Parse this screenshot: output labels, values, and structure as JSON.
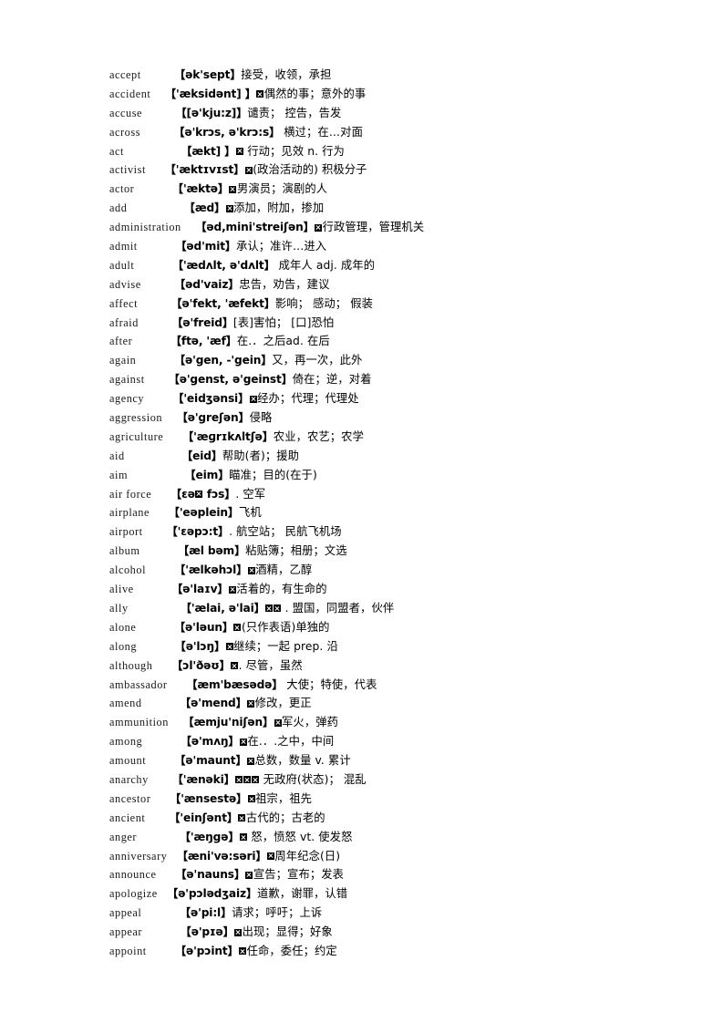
{
  "document": {
    "type": "vocabulary-glossary",
    "language_pair": "English-Chinese",
    "page_background": "#ffffff",
    "text_color": "#000000",
    "entry_count": 47
  },
  "entries": [
    {
      "word": "accept",
      "gap": 7,
      "phonetic": "【ək'sept】",
      "boxes": 0,
      "definition": "接受，收领，承担"
    },
    {
      "word": "accident",
      "gap": 3,
      "phonetic": "【'æksidənt] 】",
      "boxes": 1,
      "definition": "偶然的事；意外的事"
    },
    {
      "word": "accuse",
      "gap": 7,
      "phonetic": "【[ə'kju:z]】",
      "boxes": 0,
      "definition": "谴责；  控告，告发"
    },
    {
      "word": "across",
      "gap": 7,
      "phonetic": "【ə'krɔs, ə'krɔ:s】",
      "boxes": 0,
      "definition": "  横过；在…对面"
    },
    {
      "word": "act",
      "gap": 12,
      "phonetic": "【ækt] 】",
      "boxes": 1,
      "definition": " 行动；见效 n. 行为"
    },
    {
      "word": "activist",
      "gap": 4,
      "phonetic": "【'æktɪvɪst】",
      "boxes": 1,
      "definition": "(政治活动的) 积极分子"
    },
    {
      "word": "actor",
      "gap": 8,
      "phonetic": "【'æktə】",
      "boxes": 1,
      "definition": "男演员；演剧的人"
    },
    {
      "word": "add",
      "gap": 12,
      "phonetic": "【æd】",
      "boxes": 1,
      "definition": "添加，附加，掺加"
    },
    {
      "word": "administration",
      "gap": 3,
      "phonetic": "【əd,mini'streiʃən】",
      "boxes": 1,
      "definition": "行政管理，管理机关"
    },
    {
      "word": "admit",
      "gap": 8,
      "phonetic": "【əd'mit】",
      "boxes": 0,
      "definition": "承认；准许…进入"
    },
    {
      "word": "adult",
      "gap": 8,
      "phonetic": "【'ædʌlt, ə'dʌlt】",
      "boxes": 0,
      "definition": " 成年人 adj. 成年的"
    },
    {
      "word": "advise",
      "gap": 7,
      "phonetic": "【əd'vaiz】",
      "boxes": 0,
      "definition": "忠告，劝告，建议"
    },
    {
      "word": "affect",
      "gap": 7,
      "phonetic": "【ə'fekt, 'æfekt】",
      "boxes": 0,
      "definition": "影响；  感动；  假装"
    },
    {
      "word": "afraid",
      "gap": 7,
      "phonetic": "【ə'freid】",
      "boxes": 0,
      "definition": "[表]害怕；  [口]恐怕"
    },
    {
      "word": "after",
      "gap": 8,
      "phonetic": "【ftə, 'æf】",
      "boxes": 0,
      "definition": "在.．之后ad. 在后"
    },
    {
      "word": "again",
      "gap": 8,
      "phonetic": "【ə'gen, -'gein】",
      "boxes": 0,
      "definition": "又，再一次，此外"
    },
    {
      "word": "against",
      "gap": 5,
      "phonetic": "【ə'genst, ə'geinst】",
      "boxes": 0,
      "definition": "倚在；逆，对着"
    },
    {
      "word": "agency",
      "gap": 6,
      "phonetic": "【'eidʒənsi】",
      "boxes": 1,
      "definition": "经办；代理；代理处"
    },
    {
      "word": "aggression",
      "gap": 3,
      "phonetic": "【ə'greʃən】",
      "boxes": 0,
      "definition": "侵略"
    },
    {
      "word": "agriculture",
      "gap": 4,
      "phonetic": "【'æɡrɪkʌltʃə】",
      "boxes": 0,
      "definition": "农业，农艺；农学"
    },
    {
      "word": "aid",
      "gap": 12,
      "phonetic": "【eid】",
      "boxes": 0,
      "definition": "帮助(者)；援助"
    },
    {
      "word": "aim",
      "gap": 12,
      "phonetic": "【eim】",
      "boxes": 0,
      "definition": "瞄准；目的(在于)"
    },
    {
      "word": "air force",
      "gap": 4,
      "phonetic": "【ɛə□ fɔs】",
      "boxes": 0,
      "definition": ". 空军",
      "inline_box_after": 1
    },
    {
      "word": "airplane",
      "gap": 4,
      "phonetic": "【'eəplein】",
      "boxes": 0,
      "definition": "飞机"
    },
    {
      "word": "airport",
      "gap": 5,
      "phonetic": "【'ɛəpɔ:t】",
      "boxes": 0,
      "definition": ". 航空站；  民航飞机场"
    },
    {
      "word": "album",
      "gap": 8,
      "phonetic": "【æl bəm】",
      "boxes": 0,
      "definition": "粘贴簿；相册；文选"
    },
    {
      "word": "alcohol",
      "gap": 6,
      "phonetic": "【'ælkəhɔl】",
      "boxes": 1,
      "definition": "酒精，乙醇"
    },
    {
      "word": "alive",
      "gap": 8,
      "phonetic": "【ə'laɪv】",
      "boxes": 1,
      "definition": "活着的，有生命的"
    },
    {
      "word": "ally",
      "gap": 11,
      "phonetic": "【'ælai, ə'lai】",
      "boxes": 2,
      "definition": " . 盟国，同盟者，伙伴"
    },
    {
      "word": "alone",
      "gap": 8,
      "phonetic": "【ə'ləun】",
      "boxes": 1,
      "definition": "(只作表语)单独的"
    },
    {
      "word": "along",
      "gap": 8,
      "phonetic": "【ə'lɔŋ】",
      "boxes": 1,
      "definition": "继续；一起 prep. 沿"
    },
    {
      "word": "although",
      "gap": 4,
      "phonetic": "【ɔl'ðəʊ】",
      "boxes": 1,
      "definition": ". 尽管，虽然"
    },
    {
      "word": "ambassador",
      "gap": 4,
      "phonetic": "【æm'bæsədə】",
      "boxes": 0,
      "definition": " 大使；特使，代表"
    },
    {
      "word": "amend",
      "gap": 8,
      "phonetic": "【ə'mend】",
      "boxes": 1,
      "definition": "修改，更正"
    },
    {
      "word": "ammunition",
      "gap": 3,
      "phonetic": "【æmju'niʃən】",
      "boxes": 1,
      "definition": "军火，弹药"
    },
    {
      "word": "among",
      "gap": 8,
      "phonetic": "【ə'mʌŋ】",
      "boxes": 1,
      "definition": "在.．.之中，中间"
    },
    {
      "word": "amount",
      "gap": 6,
      "phonetic": "【ə'maunt】",
      "boxes": 1,
      "definition": "总数，数量 v. 累计"
    },
    {
      "word": "anarchy",
      "gap": 5,
      "phonetic": "【'ænəki】",
      "boxes": 3,
      "definition": " 无政府(状态)；  混乱"
    },
    {
      "word": "ancestor",
      "gap": 4,
      "phonetic": "【'ænsestə】",
      "boxes": 1,
      "definition": "祖宗，祖先"
    },
    {
      "word": "ancient",
      "gap": 5,
      "phonetic": "【'einʃənt】",
      "boxes": 1,
      "definition": "古代的；古老的"
    },
    {
      "word": "anger",
      "gap": 9,
      "phonetic": "【'æŋgə】",
      "boxes": 1,
      "definition": " 怒，愤怒 vt. 使发怒"
    },
    {
      "word": "anniversary",
      "gap": 2,
      "phonetic": "【æni'və:səri】",
      "boxes": 1,
      "definition": "周年纪念(日)"
    },
    {
      "word": "announce",
      "gap": 4,
      "phonetic": "【ə'nauns】",
      "boxes": 1,
      "definition": "宣告；宣布；发表"
    },
    {
      "word": "apologize",
      "gap": 2,
      "phonetic": "【ə'pɔlədʒaiz】",
      "boxes": 0,
      "definition": "道歉，谢罪，认错"
    },
    {
      "word": "appeal",
      "gap": 8,
      "phonetic": "【ə'pi:l】",
      "boxes": 0,
      "definition": "请求；呼吁；上诉"
    },
    {
      "word": "appear",
      "gap": 8,
      "phonetic": "【ə'pɪə】",
      "boxes": 1,
      "definition": "出现；显得；好象"
    },
    {
      "word": "appoint",
      "gap": 6,
      "phonetic": "【ə'pɔint】",
      "boxes": 1,
      "definition": "任命，委任；约定"
    }
  ]
}
